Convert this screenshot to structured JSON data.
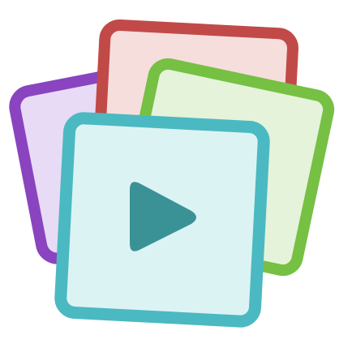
{
  "icon": {
    "name": "stacked-video-cards-icon",
    "cards": [
      {
        "name": "purple-card",
        "border": "#8a44bf",
        "fill": "#e8dbf6"
      },
      {
        "name": "red-card",
        "border": "#c14a48",
        "fill": "#f6dedd"
      },
      {
        "name": "green-card",
        "border": "#76c044",
        "fill": "#e5f3da"
      },
      {
        "name": "cyan-card",
        "border": "#4bb9c1",
        "fill": "#dcf3f4"
      }
    ],
    "play": {
      "name": "play-icon",
      "color": "#3a9296"
    }
  }
}
